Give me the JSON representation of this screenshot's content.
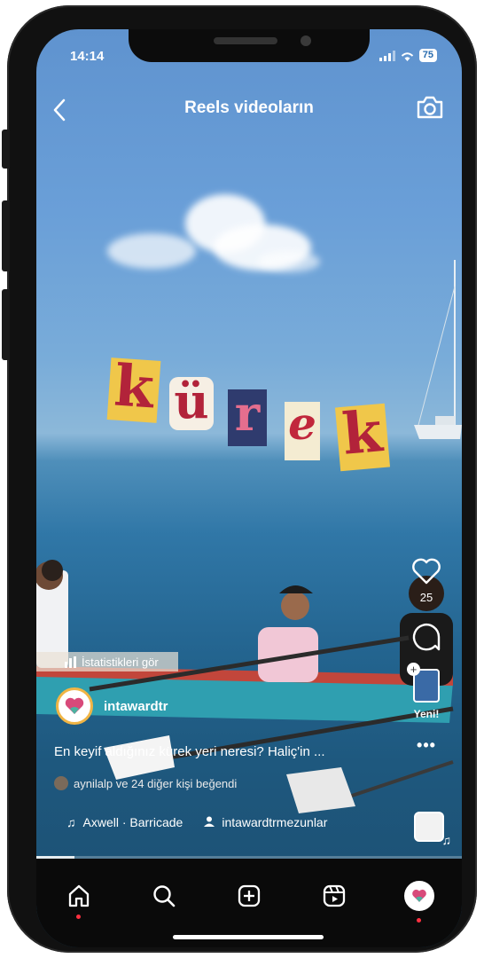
{
  "status_bar": {
    "time": "14:14",
    "battery": "75"
  },
  "header": {
    "title": "Reels videoların"
  },
  "video": {
    "overlay_letters": [
      "k",
      "ü",
      "r",
      "e",
      "k"
    ]
  },
  "actions": {
    "like_count": "25",
    "new_label": "Yeni!"
  },
  "post": {
    "stats_label": "İstatistikleri gör",
    "username": "intawardtr",
    "caption": "En keyif aldığınız kürek yeri neresi? Haliç'in ...",
    "likes_text": "aynilalp ve 24 diğer kişi beğendi",
    "audio": "Axwell · Barricade",
    "tagged_user": "intawardtrmezunlar"
  },
  "progress": {
    "fraction": 0.09
  },
  "bottom_nav": {
    "items": [
      "home-icon",
      "search-icon",
      "create-icon",
      "reels-icon",
      "profile-avatar"
    ]
  },
  "colors": {
    "accent_red": "#ff3040",
    "nav_bg": "#0a0a0a"
  }
}
